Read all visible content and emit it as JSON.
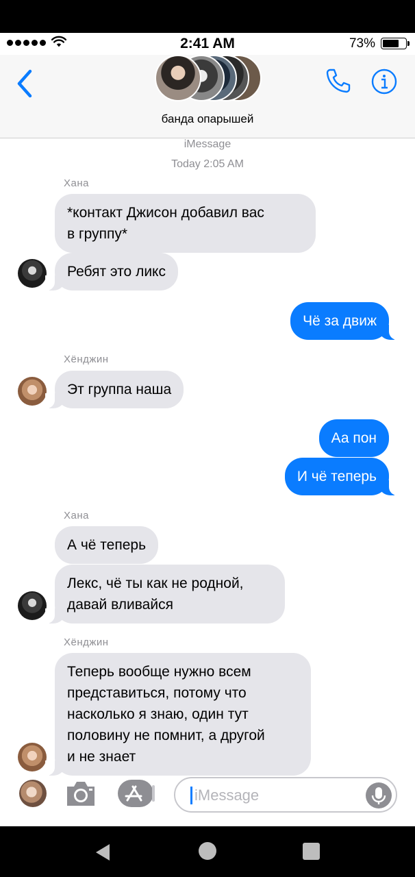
{
  "status_bar": {
    "time": "2:41 AM",
    "battery": "73%"
  },
  "header": {
    "group_name": "банда опарышей"
  },
  "thread": {
    "service": "iMessage",
    "timestamp": "Today 2:05 AM"
  },
  "messages": [
    {
      "sender": "Хана",
      "text": "*контакт Джисон добавил вас\nв группу*",
      "direction": "in"
    },
    {
      "text": "Ребят это ликс",
      "direction": "in"
    },
    {
      "text": "Чё за движ",
      "direction": "out"
    },
    {
      "sender": "Хёнджин",
      "text": "Эт группа наша",
      "direction": "in"
    },
    {
      "text": "Аа пон",
      "direction": "out"
    },
    {
      "text": "И чё теперь",
      "direction": "out"
    },
    {
      "sender": "Хана",
      "text": "А чё теперь",
      "direction": "in"
    },
    {
      "text": "Лекс, чё ты как не родной,\nдавай вливайся",
      "direction": "in"
    },
    {
      "sender": "Хёнджин",
      "text": "Теперь вообще нужно всем\nпредставиться, потому что\nнасколько я знаю, один тут\nполовину не помнит, а другой\nи не знает",
      "direction": "in"
    }
  ],
  "composer": {
    "placeholder": "iMessage"
  },
  "colors": {
    "outgoing": "#0a7cff",
    "incoming": "#e5e5ea",
    "accent": "#0a7cff"
  }
}
